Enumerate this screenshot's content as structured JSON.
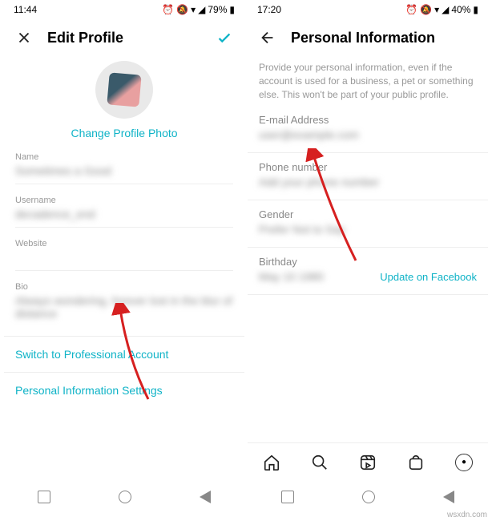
{
  "left": {
    "status": {
      "time": "11:44",
      "battery": "79%"
    },
    "header": {
      "title": "Edit Profile"
    },
    "avatar": {
      "change_photo": "Change Profile Photo"
    },
    "fields": {
      "name_label": "Name",
      "name_value": "Sometimes a Good",
      "username_label": "Username",
      "username_value": "decadence_end",
      "website_label": "Website",
      "website_value": "",
      "bio_label": "Bio",
      "bio_value": "Always wondering, forever lost in the blur of distance"
    },
    "links": {
      "switch_professional": "Switch to Professional Account",
      "personal_info": "Personal Information Settings"
    }
  },
  "right": {
    "status": {
      "time": "17:20",
      "battery": "40%"
    },
    "header": {
      "title": "Personal Information"
    },
    "description": "Provide your personal information, even if the account is used for a business, a pet or something else. This won't be part of your public profile.",
    "fields": {
      "email_label": "E-mail Address",
      "email_value": "user@example.com",
      "phone_label": "Phone number",
      "phone_value": "Add your phone number",
      "gender_label": "Gender",
      "gender_value": "Prefer Not to Say",
      "birthday_label": "Birthday",
      "birthday_value": "May 10 1980",
      "update_fb": "Update on Facebook"
    }
  },
  "watermark": "wsxdn.com"
}
